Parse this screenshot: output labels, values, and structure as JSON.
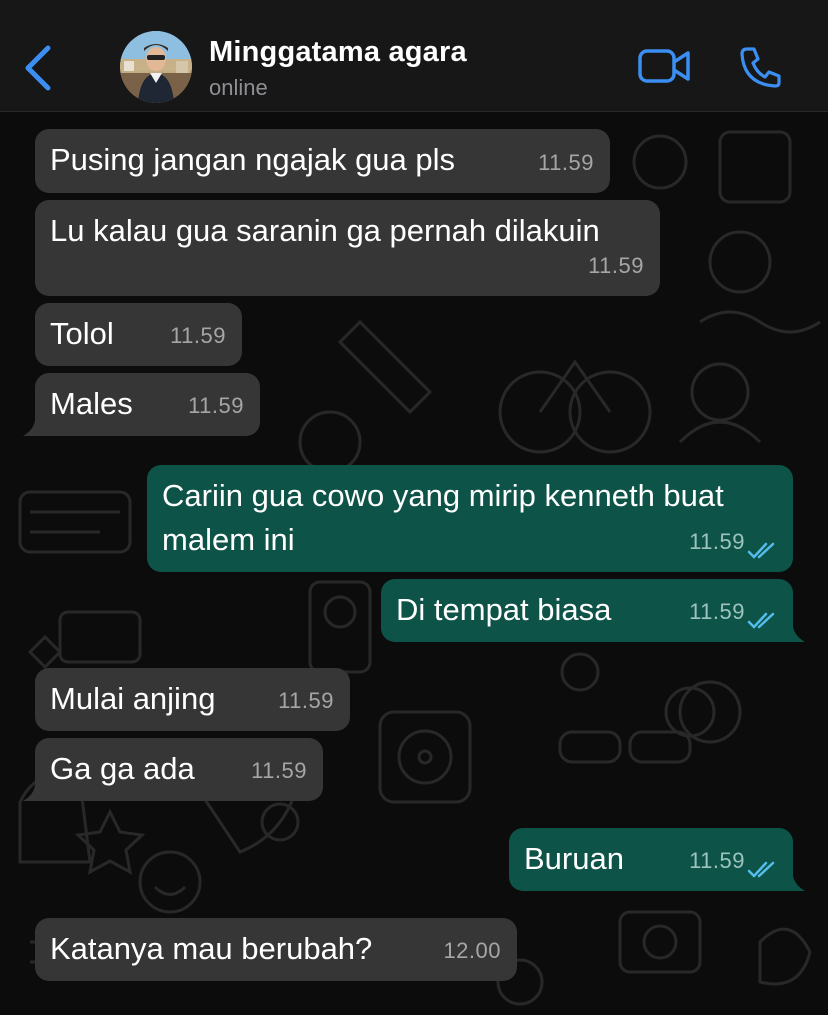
{
  "header": {
    "contact_name": "Minggatama agara",
    "status": "online"
  },
  "icons": {
    "back": "chevron-left-icon",
    "video": "video-camera-icon",
    "call": "phone-icon",
    "read_receipt": "double-check-icon"
  },
  "colors": {
    "accent": "#3b8ff2",
    "incoming_bubble": "#363636",
    "outgoing_bubble": "#0e5348",
    "read_ticks": "#53bdeb"
  },
  "messages": [
    {
      "dir": "in",
      "text": "Pusing jangan ngajak gua pls",
      "time": "11.59"
    },
    {
      "dir": "in",
      "text": "Lu kalau gua saranin ga pernah dilakuin",
      "time": "11.59"
    },
    {
      "dir": "in",
      "text": "Tolol",
      "time": "11.59"
    },
    {
      "dir": "in",
      "text": "Males",
      "time": "11.59"
    },
    {
      "dir": "out",
      "text": "Cariin gua cowo yang mirip kenneth buat malem ini",
      "time": "11.59",
      "status": "read"
    },
    {
      "dir": "out",
      "text": "Di tempat biasa",
      "time": "11.59",
      "status": "read"
    },
    {
      "dir": "in",
      "text": "Mulai anjing",
      "time": "11.59"
    },
    {
      "dir": "in",
      "text": "Ga ga ada",
      "time": "11.59"
    },
    {
      "dir": "out",
      "text": "Buruan",
      "time": "11.59",
      "status": "read"
    },
    {
      "dir": "in",
      "text": "Katanya mau berubah?",
      "time": "12.00"
    }
  ]
}
